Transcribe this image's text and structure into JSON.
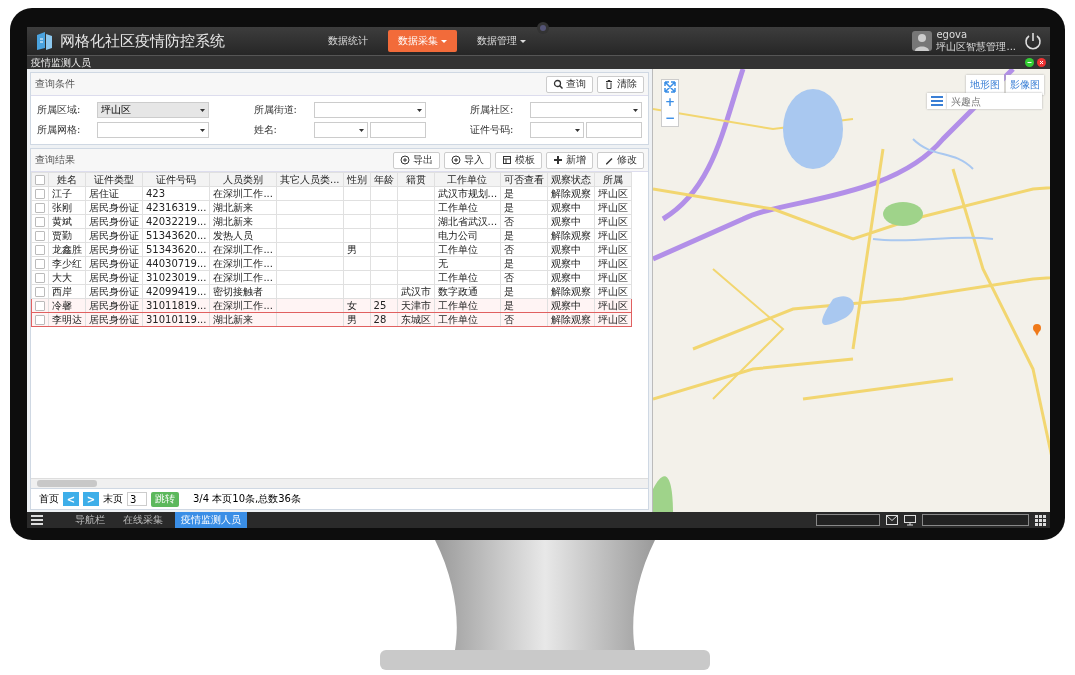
{
  "app": {
    "title": "网格化社区疫情防控系统",
    "nav": [
      {
        "label": "数据统计",
        "selected": false,
        "dropdown": false
      },
      {
        "label": "数据采集",
        "selected": true,
        "dropdown": true
      },
      {
        "label": "数据管理",
        "selected": false,
        "dropdown": true
      }
    ],
    "user": {
      "name": "egova",
      "org": "坪山区智慧管理..."
    }
  },
  "window": {
    "title": "疫情监测人员"
  },
  "query": {
    "title": "查询条件",
    "buttons": [
      {
        "label": "查询"
      },
      {
        "label": "清除"
      }
    ],
    "fields": [
      {
        "label": "所属区域:",
        "value": "坪山区",
        "kind": "select",
        "disabled": true
      },
      {
        "label": "所属街道:",
        "kind": "select",
        "disabled": false
      },
      {
        "label": "所属社区:",
        "kind": "select",
        "disabled": false
      },
      {
        "label": "所属网格:",
        "kind": "select",
        "disabled": false
      },
      {
        "label": "姓名:",
        "kind": "select-text",
        "disabled": false
      },
      {
        "label": "证件号码:",
        "kind": "select-text",
        "disabled": false
      }
    ]
  },
  "results": {
    "title": "查询结果",
    "buttons": [
      {
        "label": "导出"
      },
      {
        "label": "导入"
      },
      {
        "label": "模板"
      },
      {
        "label": "新增"
      },
      {
        "label": "修改"
      }
    ],
    "all_checked": false,
    "columns": [
      "姓名",
      "证件类型",
      "证件号码",
      "人员类别",
      "其它人员类...",
      "性别",
      "年龄",
      "籍贯",
      "工作单位",
      "可否查看",
      "观察状态",
      "所属"
    ],
    "rows": [
      {
        "checked": false,
        "selected": false,
        "cells": [
          "江子",
          "居住证",
          "423",
          "在深圳工作...",
          "",
          "",
          "",
          "",
          "武汉市规划...",
          "是",
          "解除观察",
          "坪山区"
        ]
      },
      {
        "checked": false,
        "selected": false,
        "cells": [
          "张刚",
          "居民身份证",
          "42316319...",
          "湖北新来",
          "",
          "",
          "",
          "",
          "工作单位",
          "是",
          "观察中",
          "坪山区"
        ]
      },
      {
        "checked": false,
        "selected": false,
        "cells": [
          "黄斌",
          "居民身份证",
          "42032219...",
          "湖北新来",
          "",
          "",
          "",
          "",
          "湖北省武汉...",
          "否",
          "观察中",
          "坪山区"
        ]
      },
      {
        "checked": false,
        "selected": false,
        "cells": [
          "贾勤",
          "居民身份证",
          "51343620...",
          "发热人员",
          "",
          "",
          "",
          "",
          "电力公司",
          "是",
          "解除观察",
          "坪山区"
        ]
      },
      {
        "checked": false,
        "selected": false,
        "cells": [
          "龙鑫胜",
          "居民身份证",
          "51343620...",
          "在深圳工作...",
          "",
          "男",
          "",
          "",
          "工作单位",
          "否",
          "观察中",
          "坪山区"
        ]
      },
      {
        "checked": false,
        "selected": false,
        "cells": [
          "李少红",
          "居民身份证",
          "44030719...",
          "在深圳工作...",
          "",
          "",
          "",
          "",
          "无",
          "是",
          "观察中",
          "坪山区"
        ]
      },
      {
        "checked": false,
        "selected": false,
        "cells": [
          "大大",
          "居民身份证",
          "31023019...",
          "在深圳工作...",
          "",
          "",
          "",
          "",
          "工作单位",
          "否",
          "观察中",
          "坪山区"
        ]
      },
      {
        "checked": false,
        "selected": false,
        "cells": [
          "西岸",
          "居民身份证",
          "42099419...",
          "密切接触者",
          "",
          "",
          "",
          "武汉市",
          "数字政通",
          "是",
          "解除观察",
          "坪山区"
        ]
      },
      {
        "checked": false,
        "selected": true,
        "cells": [
          "冷馨",
          "居民身份证",
          "31011819...",
          "在深圳工作...",
          "",
          "女",
          "25",
          "天津市",
          "工作单位",
          "是",
          "观察中",
          "坪山区"
        ]
      },
      {
        "checked": false,
        "selected": true,
        "cells": [
          "李明达",
          "居民身份证",
          "31010119...",
          "湖北新来",
          "",
          "男",
          "28",
          "东城区",
          "工作单位",
          "否",
          "解除观察",
          "坪山区"
        ]
      }
    ]
  },
  "pager": {
    "first": "首页",
    "prev": "<",
    "next": ">",
    "last": "末页",
    "page": "3",
    "jump": "跳转",
    "summary": "3/4 本页10条,总数36条"
  },
  "map": {
    "layers": [
      "地形图",
      "影像图"
    ],
    "search": {
      "placeholder": "兴趣点"
    },
    "zoom_in": "+",
    "zoom_out": "−"
  },
  "taskbar": {
    "tabs": [
      {
        "label": "导航栏",
        "selected": false
      },
      {
        "label": "在线采集",
        "selected": false
      },
      {
        "label": "疫情监测人员",
        "selected": true
      }
    ]
  }
}
